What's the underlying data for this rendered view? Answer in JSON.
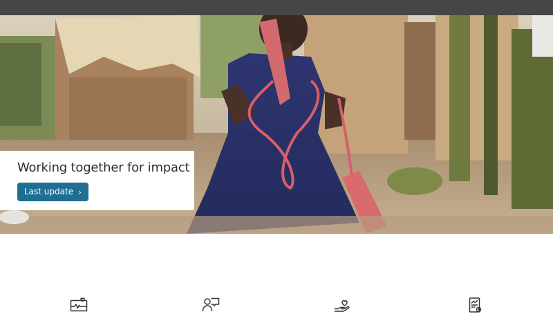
{
  "hero": {
    "title": "Working together for impact",
    "button_label": "Last update",
    "button_icon": "chevron-right-icon",
    "colors": {
      "button_bg": "#1f6f95",
      "topbar": "#464646"
    }
  },
  "features": {
    "items": [
      {
        "icon": "monitor-heart-icon"
      },
      {
        "icon": "user-chat-icon"
      },
      {
        "icon": "hand-heart-icon"
      },
      {
        "icon": "report-chart-icon"
      }
    ]
  }
}
